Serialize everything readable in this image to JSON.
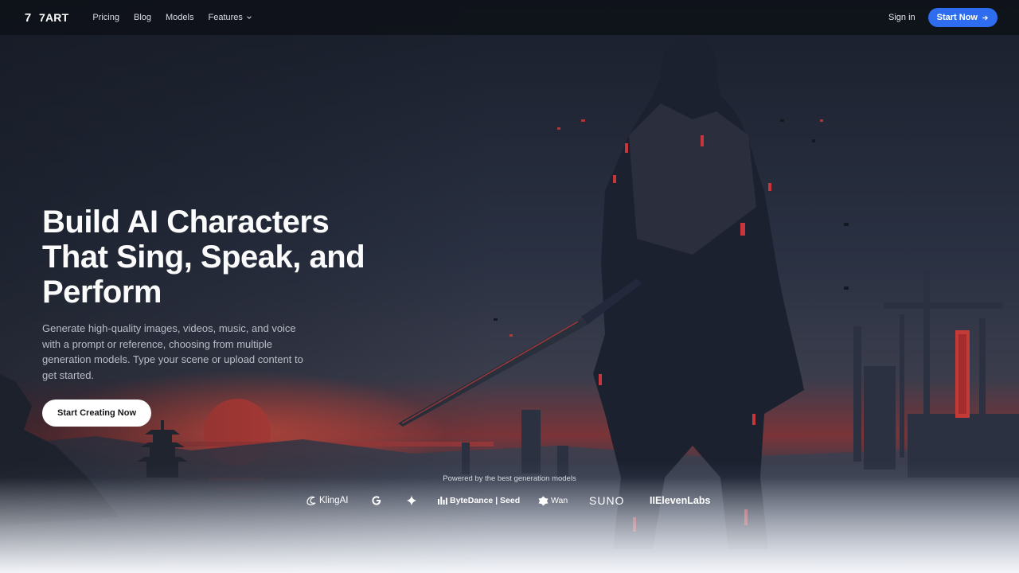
{
  "brand": {
    "mark": "7",
    "name": "7ART"
  },
  "nav": {
    "items": [
      {
        "label": "Pricing"
      },
      {
        "label": "Blog"
      },
      {
        "label": "Models"
      },
      {
        "label": "Features"
      }
    ]
  },
  "auth": {
    "signin_label": "Sign in",
    "start_label": "Start Now"
  },
  "hero": {
    "title_lines": [
      "Build AI Characters",
      "That Sing, Speak, and",
      "Perform"
    ],
    "description": "Generate high-quality images, videos, music, and voice with a prompt or reference, choosing from multiple generation models. Type your scene or upload content to get started.",
    "cta_label": "Start Creating Now"
  },
  "partners": {
    "caption": "Powered by the best generation models",
    "logos": [
      {
        "name": "KlingAI",
        "icon": "kling-icon"
      },
      {
        "name": "",
        "icon": "google-icon"
      },
      {
        "name": "",
        "icon": "gemini-sparkle-icon"
      },
      {
        "name": "ByteDance | Seed",
        "icon": "bytedance-icon"
      },
      {
        "name": "Wan",
        "icon": "wan-icon"
      },
      {
        "name": "SUNO",
        "icon": "suno-wordmark"
      },
      {
        "name": "IIElevenLabs",
        "icon": "elevenlabs-wordmark"
      }
    ]
  },
  "colors": {
    "accent": "#2f6df0",
    "sun": "#e0453c",
    "sky_top": "#1e2433",
    "sky_horizon": "#9a3a3c"
  }
}
